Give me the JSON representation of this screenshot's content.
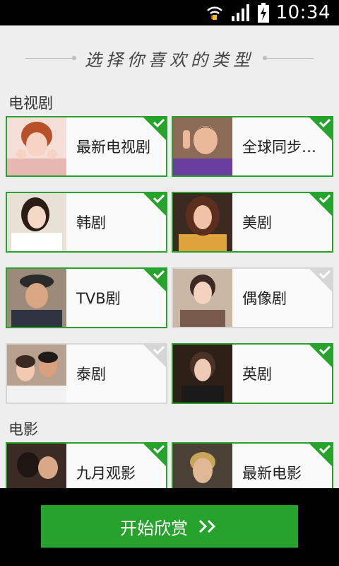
{
  "status_bar": {
    "time": "10:34",
    "icons": [
      "wifi-icon",
      "signal-icon",
      "battery-charging-icon"
    ]
  },
  "header": {
    "title": "选择你喜欢的类型"
  },
  "sections": [
    {
      "title": "电视剧",
      "items": [
        {
          "label": "最新电视剧",
          "selected": true
        },
        {
          "label": "全球同步…",
          "selected": true
        },
        {
          "label": "韩剧",
          "selected": true
        },
        {
          "label": "美剧",
          "selected": true
        },
        {
          "label": "TVB剧",
          "selected": true
        },
        {
          "label": "偶像剧",
          "selected": false
        },
        {
          "label": "泰剧",
          "selected": false
        },
        {
          "label": "英剧",
          "selected": true
        }
      ]
    },
    {
      "title": "电影",
      "items": [
        {
          "label": "九月观影",
          "selected": true
        },
        {
          "label": "最新电影",
          "selected": true
        }
      ]
    }
  ],
  "start_button": {
    "label": "开始欣赏",
    "icon": "double-chevron-right-icon"
  },
  "colors": {
    "accent": "#27a22c",
    "background": "#eeeeee",
    "unselected_border": "#d6d6d6"
  }
}
